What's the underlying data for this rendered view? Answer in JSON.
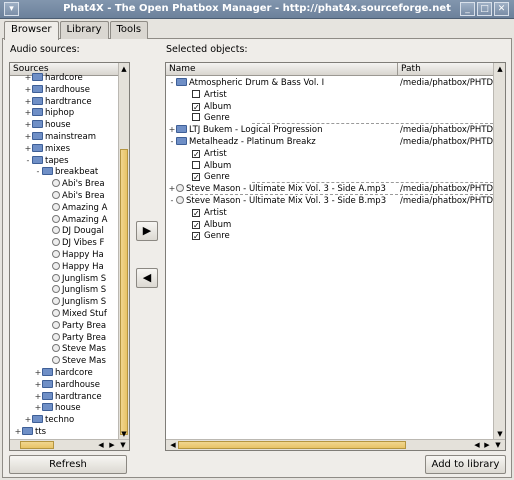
{
  "window": {
    "title": "Phat4X - The Open Phatbox Manager - http://phat4x.sourceforge.net"
  },
  "tabs": [
    {
      "label": "Browser"
    },
    {
      "label": "Library"
    },
    {
      "label": "Tools"
    }
  ],
  "left": {
    "label": "Audio sources:",
    "header": "Sources",
    "items": [
      {
        "label": "hardcore",
        "type": "folder",
        "indent": 1,
        "exp": "+"
      },
      {
        "label": "hardhouse",
        "type": "folder",
        "indent": 1,
        "exp": "+"
      },
      {
        "label": "hardtrance",
        "type": "folder",
        "indent": 1,
        "exp": "+"
      },
      {
        "label": "hiphop",
        "type": "folder",
        "indent": 1,
        "exp": "+"
      },
      {
        "label": "house",
        "type": "folder",
        "indent": 1,
        "exp": "+"
      },
      {
        "label": "mainstream",
        "type": "folder",
        "indent": 1,
        "exp": "+"
      },
      {
        "label": "mixes",
        "type": "folder",
        "indent": 1,
        "exp": "+"
      },
      {
        "label": "tapes",
        "type": "folder",
        "indent": 1,
        "exp": "-"
      },
      {
        "label": "breakbeat",
        "type": "folder",
        "indent": 2,
        "exp": "-"
      },
      {
        "label": "Abi's Brea",
        "type": "file",
        "indent": 3
      },
      {
        "label": "Abi's Brea",
        "type": "file",
        "indent": 3
      },
      {
        "label": "Amazing A",
        "type": "file",
        "indent": 3
      },
      {
        "label": "Amazing A",
        "type": "file",
        "indent": 3
      },
      {
        "label": "DJ Dougal",
        "type": "file",
        "indent": 3
      },
      {
        "label": "DJ Vibes F",
        "type": "file",
        "indent": 3
      },
      {
        "label": "Happy Ha",
        "type": "file",
        "indent": 3
      },
      {
        "label": "Happy Ha",
        "type": "file",
        "indent": 3
      },
      {
        "label": "Junglism S",
        "type": "file",
        "indent": 3
      },
      {
        "label": "Junglism S",
        "type": "file",
        "indent": 3
      },
      {
        "label": "Junglism S",
        "type": "file",
        "indent": 3
      },
      {
        "label": "Mixed Stuf",
        "type": "file",
        "indent": 3
      },
      {
        "label": "Party Brea",
        "type": "file",
        "indent": 3
      },
      {
        "label": "Party Brea",
        "type": "file",
        "indent": 3
      },
      {
        "label": "Steve Mas",
        "type": "file",
        "indent": 3
      },
      {
        "label": "Steve Mas",
        "type": "file",
        "indent": 3
      },
      {
        "label": "hardcore",
        "type": "folder",
        "indent": 2,
        "exp": "+"
      },
      {
        "label": "hardhouse",
        "type": "folder",
        "indent": 2,
        "exp": "+"
      },
      {
        "label": "hardtrance",
        "type": "folder",
        "indent": 2,
        "exp": "+"
      },
      {
        "label": "house",
        "type": "folder",
        "indent": 2,
        "exp": "+"
      },
      {
        "label": "techno",
        "type": "folder",
        "indent": 1,
        "exp": "+"
      },
      {
        "label": "tts",
        "type": "folder",
        "indent": 0,
        "exp": "+"
      }
    ],
    "refresh_label": "Refresh"
  },
  "right": {
    "label": "Selected objects:",
    "col_name": "Name",
    "col_path": "Path",
    "items": [
      {
        "label": "Atmospheric Drum & Bass Vol. I",
        "path": "/media/phatbox/PHTDATA",
        "type": "folder",
        "indent": 0,
        "exp": "-"
      },
      {
        "label": "Artist",
        "type": "check",
        "checked": false,
        "indent": 1
      },
      {
        "label": "Album",
        "type": "check",
        "checked": true,
        "indent": 1
      },
      {
        "label": "Genre",
        "type": "check",
        "checked": false,
        "indent": 1
      },
      {
        "label": "LTJ Bukem - Logical Progression",
        "path": "/media/phatbox/PHTDATA",
        "type": "folder",
        "indent": 0,
        "exp": "+"
      },
      {
        "label": "Metalheadz - Platinum Breakz",
        "path": "/media/phatbox/PHTDATA",
        "type": "folder",
        "indent": 0,
        "exp": "-"
      },
      {
        "label": "Artist",
        "type": "check",
        "checked": true,
        "indent": 1
      },
      {
        "label": "Album",
        "type": "check",
        "checked": false,
        "indent": 1
      },
      {
        "label": "Genre",
        "type": "check",
        "checked": true,
        "indent": 1
      },
      {
        "label": "Steve Mason - Ultimate Mix Vol. 3 - Side A.mp3",
        "path": "/media/phatbox/PHTDATA",
        "type": "file",
        "indent": 0,
        "exp": "+"
      },
      {
        "label": "Steve Mason - Ultimate Mix Vol. 3 - Side B.mp3",
        "path": "/media/phatbox/PHTDATA",
        "type": "file",
        "indent": 0,
        "exp": "-"
      },
      {
        "label": "Artist",
        "type": "check",
        "checked": true,
        "indent": 1
      },
      {
        "label": "Album",
        "type": "check",
        "checked": true,
        "indent": 1
      },
      {
        "label": "Genre",
        "type": "check",
        "checked": true,
        "indent": 1
      }
    ],
    "add_label": "Add to library"
  },
  "transfer": {
    "add_arrow": "▶",
    "remove_arrow": "◀"
  },
  "icons": {
    "menu": "window-menu-icon",
    "minimize": "minimize-icon",
    "maximize": "maximize-icon",
    "close": "close-icon"
  }
}
